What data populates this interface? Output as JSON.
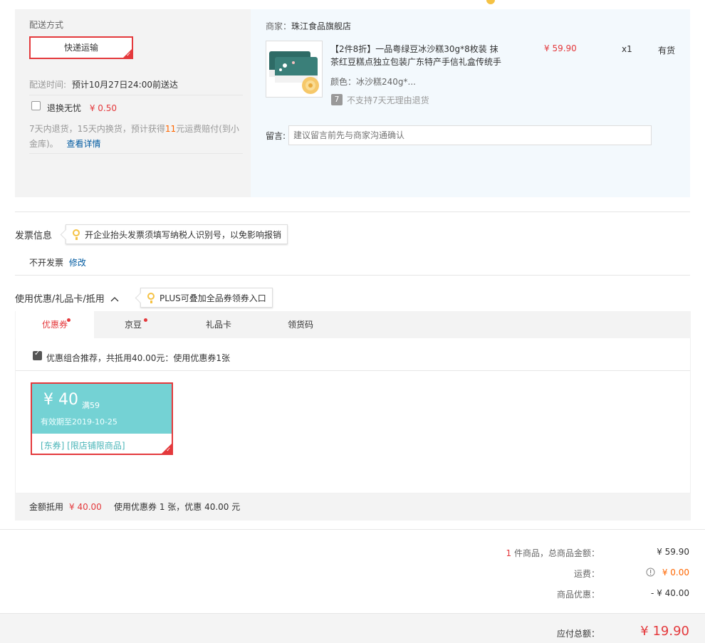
{
  "top_strip": {
    "items": [
      "",
      "",
      ""
    ]
  },
  "shipping": {
    "section_title": "配送方式",
    "method_label": "快递运输",
    "time_label": "配送时间:",
    "time_value": "预计10月27日24:00前送达",
    "insurance_label": "退换无忧",
    "insurance_price": "¥ 0.50",
    "insurance_desc_1": "7天内退货，15天内换货，预计获得",
    "insurance_desc_num": "11",
    "insurance_desc_2": "元运费赔付(到小",
    "insurance_desc_3": "金库)。",
    "details_link": "查看详情"
  },
  "seller": {
    "label": "商家：",
    "name": "珠江食品旗舰店"
  },
  "product": {
    "title_line1": "【2件8折】一品粤绿豆冰沙糕30g*8枚装 抹",
    "title_line2": "茶红豆糕点独立包装广东特产手信礼盒传统手",
    "color": "颜色：冰沙糕240g*...",
    "return_badge": "7",
    "return_note": "不支持7天无理由退货",
    "price": "¥ 59.90",
    "qty": "x1",
    "stock": "有货"
  },
  "remark": {
    "label": "留言:",
    "placeholder": "建议留言前先与商家沟通确认"
  },
  "invoice": {
    "title": "发票信息",
    "tip": "开企业抬头发票须填写纳税人识别号，以免影响报销",
    "status": "不开发票",
    "edit_link": "修改"
  },
  "coupons": {
    "title": "使用优惠/礼品卡/抵用",
    "toggle_icon": "chevron-up-icon",
    "tip": "PLUS可叠加全品券领券入口",
    "tabs": [
      {
        "label": "优惠券",
        "dot": true
      },
      {
        "label": "京豆",
        "dot": true
      },
      {
        "label": "礼品卡",
        "dot": false
      },
      {
        "label": "领货码",
        "dot": false
      }
    ],
    "recommend_text": "优惠组合推荐，共抵用40.00元：使用优惠券1张",
    "coupon": {
      "amount": "¥ 40",
      "condition": "满59",
      "validity": "有效期至2019-10-25",
      "tags": "[东券] [限店铺限商品]"
    },
    "summary_label": "金额抵用",
    "summary_amount": "¥ 40.00",
    "summary_desc": "使用优惠券 1 张，优惠 40.00 元"
  },
  "totals": {
    "count": "1",
    "goods_label": " 件商品，总商品金额：",
    "goods_value": "¥ 59.90",
    "shipping_label": "运费：",
    "shipping_value": "¥ 0.00",
    "discount_label": "商品优惠：",
    "discount_value": "- ¥ 40.00",
    "payable_label": "应付总额：",
    "payable_value": "¥ 19.90"
  },
  "colors": {
    "accent": "#e4393c",
    "coupon_bg": "#74d2d4",
    "link": "#005aa0",
    "tip_bulb": "#f5c244"
  }
}
